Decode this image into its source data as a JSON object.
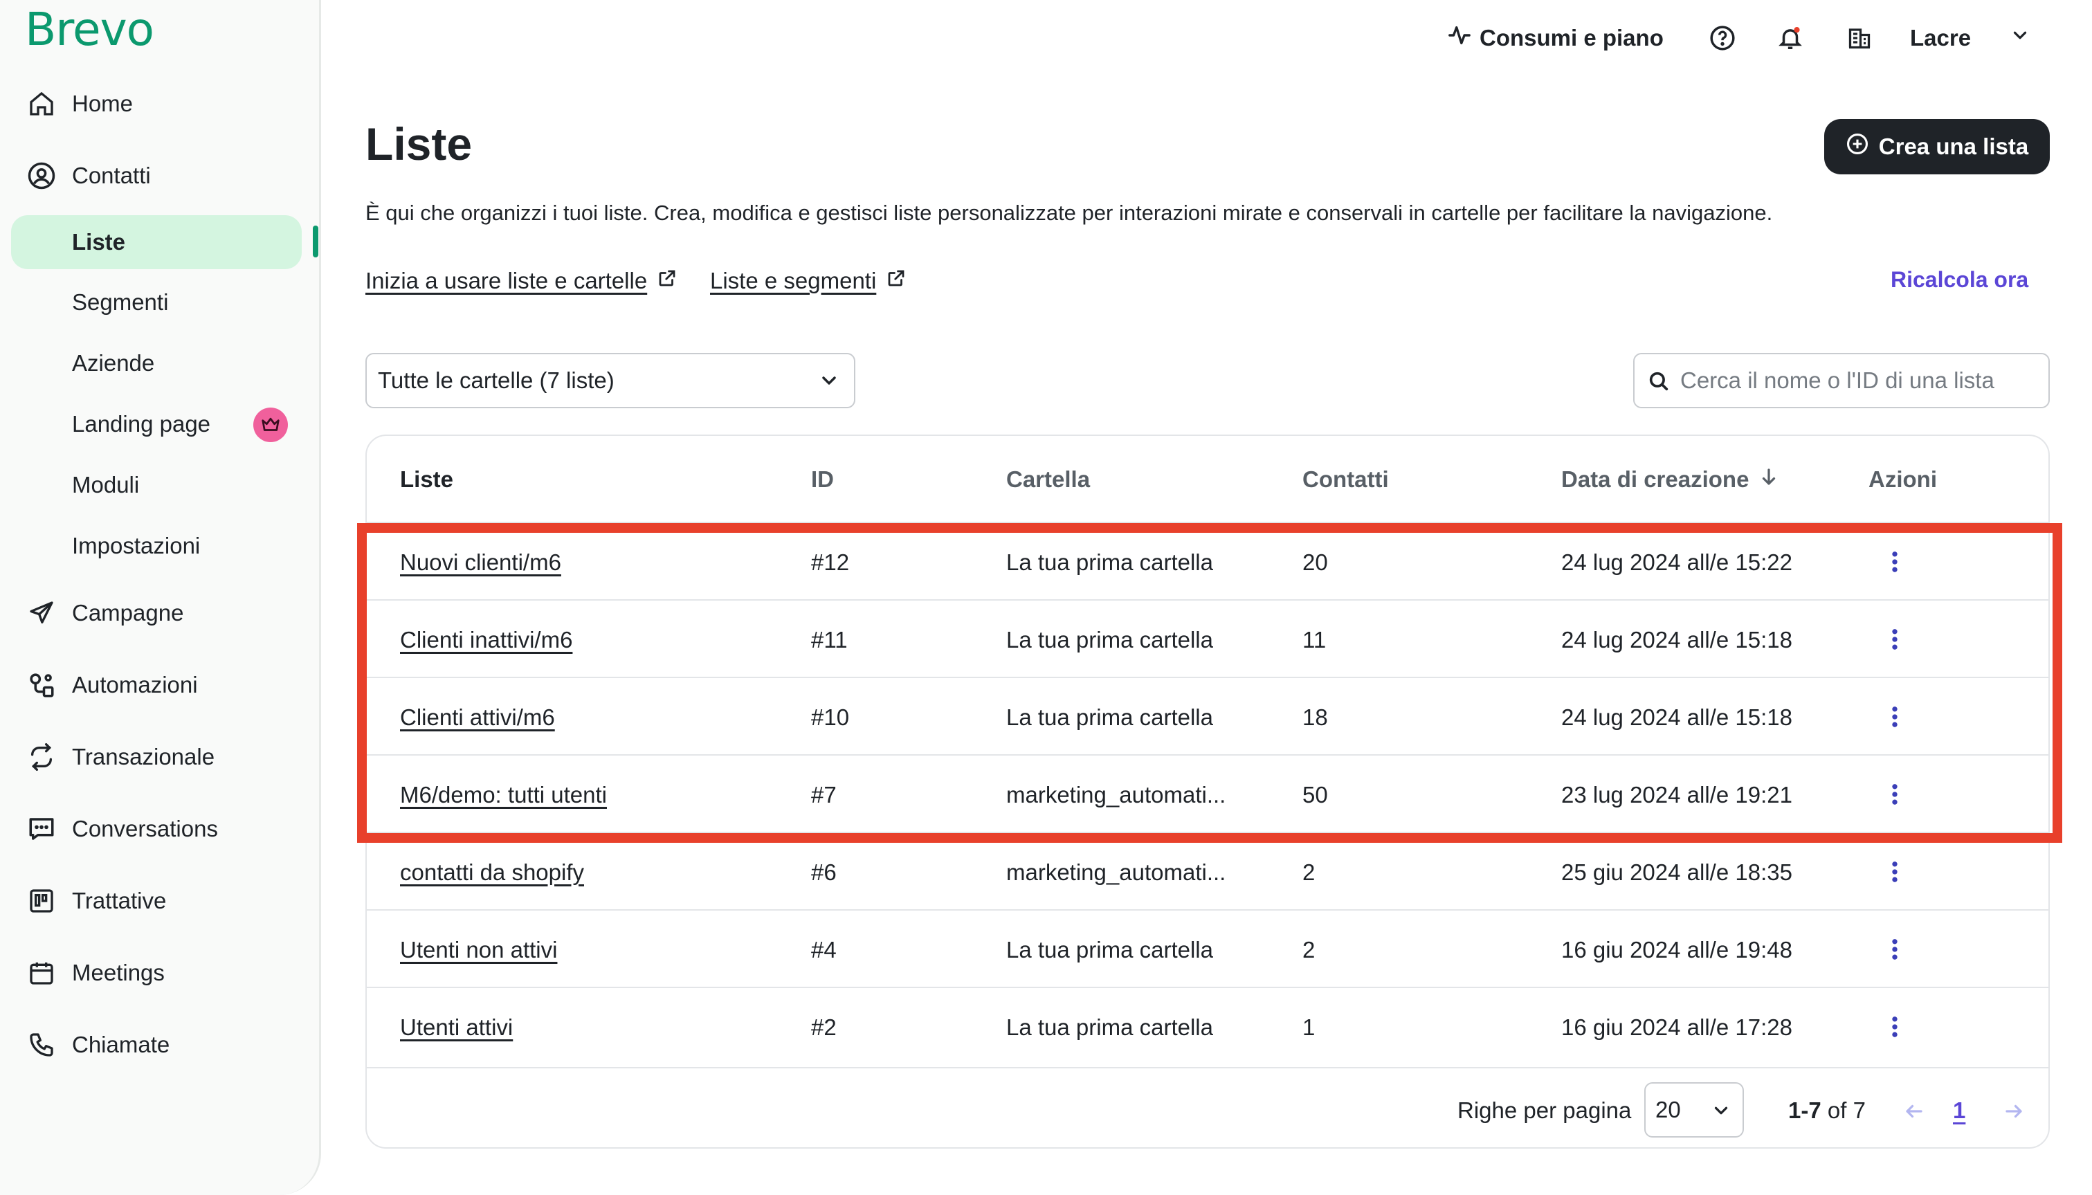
{
  "app": {
    "logo_text": "Brevo",
    "brand_color": "#0b996e",
    "accent_color": "#5b46d6",
    "highlight_color": "#e8402b"
  },
  "sidebar": {
    "items": [
      {
        "label": "Home",
        "icon": "home-icon"
      },
      {
        "label": "Contatti",
        "icon": "contact-icon"
      },
      {
        "label": "Campagne",
        "icon": "send-icon"
      },
      {
        "label": "Automazioni",
        "icon": "automation-icon"
      },
      {
        "label": "Transazionale",
        "icon": "transactional-icon"
      },
      {
        "label": "Conversations",
        "icon": "chat-icon"
      },
      {
        "label": "Trattative",
        "icon": "deals-icon"
      },
      {
        "label": "Meetings",
        "icon": "calendar-icon"
      },
      {
        "label": "Chiamate",
        "icon": "phone-icon"
      }
    ],
    "contacts_sub": [
      {
        "label": "Liste",
        "active": true
      },
      {
        "label": "Segmenti"
      },
      {
        "label": "Aziende"
      },
      {
        "label": "Landing page",
        "badge_icon": "crown-icon"
      },
      {
        "label": "Moduli"
      },
      {
        "label": "Impostazioni"
      }
    ]
  },
  "topbar": {
    "usage_label": "Consumi e piano",
    "account_name": "Lacre"
  },
  "header": {
    "title": "Liste",
    "create_button": "Crea una lista",
    "description": "È qui che organizzi i tuoi liste. Crea, modifica e gestisci liste personalizzate per interazioni mirate e conservali in cartelle per facilitare la navigazione.",
    "links": [
      "Inizia a usare liste e cartelle",
      "Liste e segmenti"
    ],
    "recalc": "Ricalcola ora"
  },
  "filters": {
    "folder_select": "Tutte le cartelle (7 liste)",
    "search_placeholder": "Cerca il nome o l'ID di una lista"
  },
  "table": {
    "columns": [
      "Liste",
      "ID",
      "Cartella",
      "Contatti",
      "Data di creazione",
      "Azioni"
    ],
    "rows": [
      {
        "name": "Nuovi clienti/m6",
        "id": "#12",
        "folder": "La tua prima cartella",
        "contacts": "20",
        "created": "24 lug 2024 all/e 15:22"
      },
      {
        "name": "Clienti inattivi/m6",
        "id": "#11",
        "folder": "La tua prima cartella",
        "contacts": "11",
        "created": "24 lug 2024 all/e 15:18"
      },
      {
        "name": "Clienti attivi/m6",
        "id": "#10",
        "folder": "La tua prima cartella",
        "contacts": "18",
        "created": "24 lug 2024 all/e 15:18"
      },
      {
        "name": "M6/demo: tutti utenti",
        "id": "#7",
        "folder": "marketing_automati...",
        "contacts": "50",
        "created": "23 lug 2024 all/e 19:21"
      },
      {
        "name": "contatti da shopify",
        "id": "#6",
        "folder": "marketing_automati...",
        "contacts": "2",
        "created": "25 giu 2024 all/e 18:35"
      },
      {
        "name": "Utenti non attivi",
        "id": "#4",
        "folder": "La tua prima cartella",
        "contacts": "2",
        "created": "16 giu 2024 all/e 19:48"
      },
      {
        "name": "Utenti attivi",
        "id": "#2",
        "folder": "La tua prima cartella",
        "contacts": "1",
        "created": "16 giu 2024 all/e 17:28"
      }
    ],
    "footer": {
      "rows_per_page_label": "Righe per pagina",
      "rows_per_page_value": "20",
      "range": "1-7",
      "of_total": "of 7",
      "current_page": "1"
    }
  }
}
